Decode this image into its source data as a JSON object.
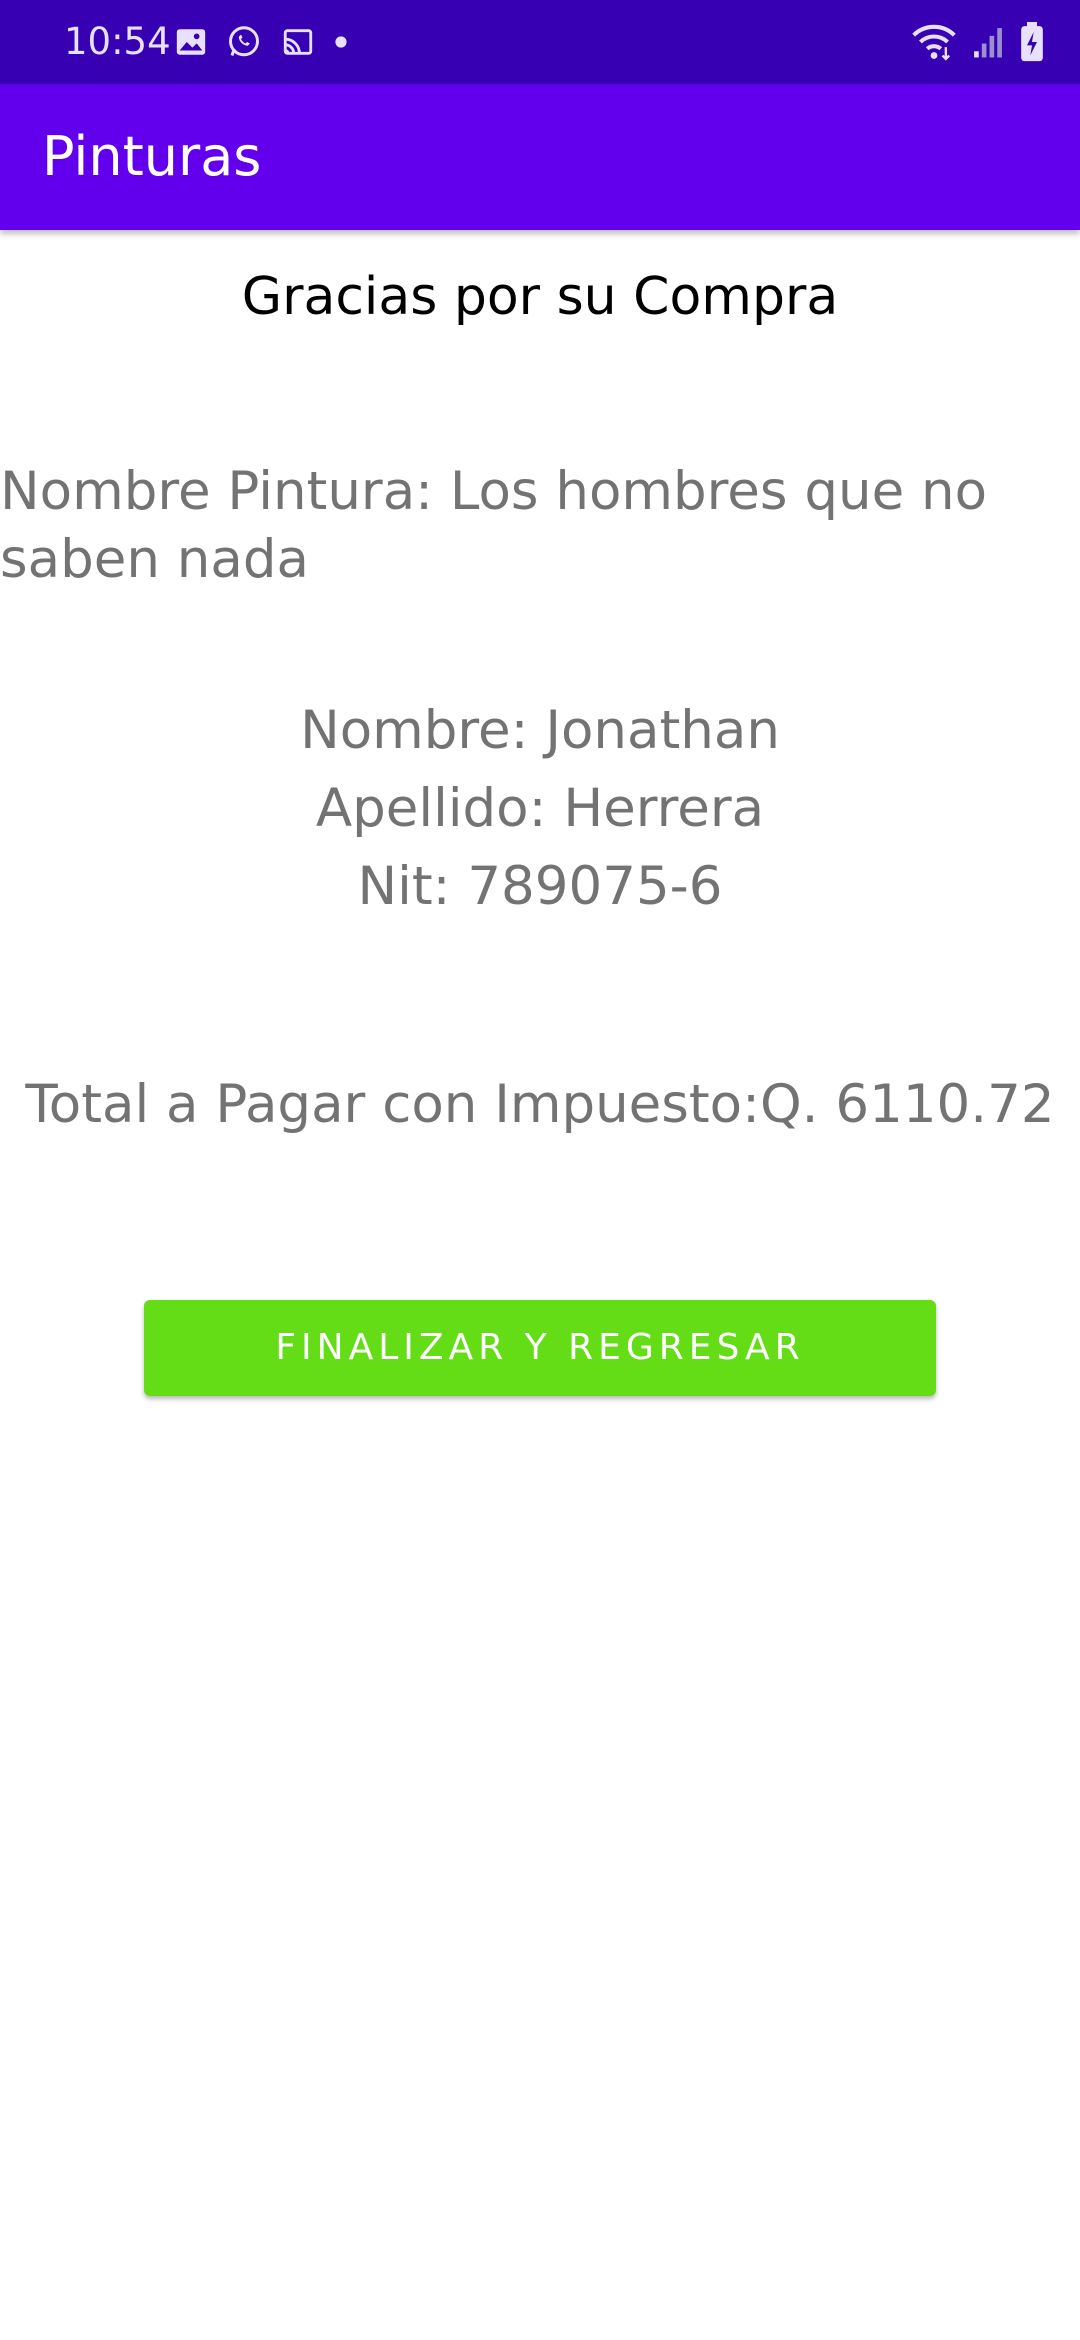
{
  "status_bar": {
    "time": "10:54",
    "left_icons": [
      "image-icon",
      "whatsapp-icon",
      "cast-icon",
      "dot-icon"
    ],
    "right_icons": [
      "wifi-icon",
      "signal-icon",
      "battery-charging-icon"
    ]
  },
  "app_bar": {
    "title": "Pinturas",
    "color": "#6200ee",
    "status_color": "#3700b3"
  },
  "main": {
    "thanks": "Gracias por su Compra",
    "painting_name": "Nombre Pintura: Los hombres que no saben nada",
    "first_name": "Nombre: Jonathan",
    "last_name": "Apellido: Herrera",
    "nit": "Nit: 789075-6",
    "total": "Total a Pagar con Impuesto:Q. 6110.72"
  },
  "button": {
    "label": "FINALIZAR Y REGRESAR",
    "color": "#64dd17"
  }
}
